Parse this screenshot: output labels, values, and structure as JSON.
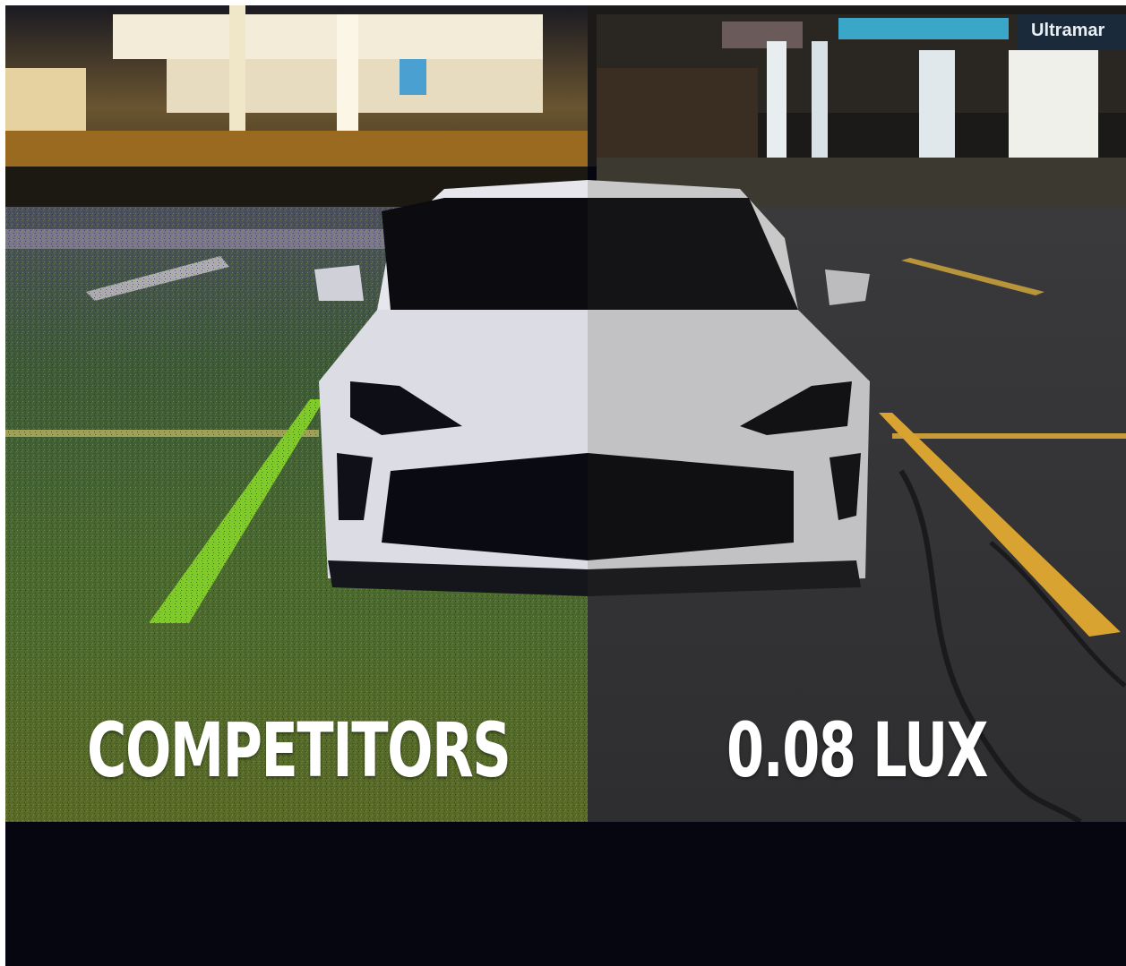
{
  "comparison": {
    "left_label": "COMPETITORS",
    "right_label": "0.08 LUX",
    "right_sign_text": "Ultramar"
  },
  "colors": {
    "footer_band": "#05060f",
    "label_text": "#ffffff",
    "left_line_color": "#7ecb2a",
    "right_line_color": "#d9a331"
  }
}
